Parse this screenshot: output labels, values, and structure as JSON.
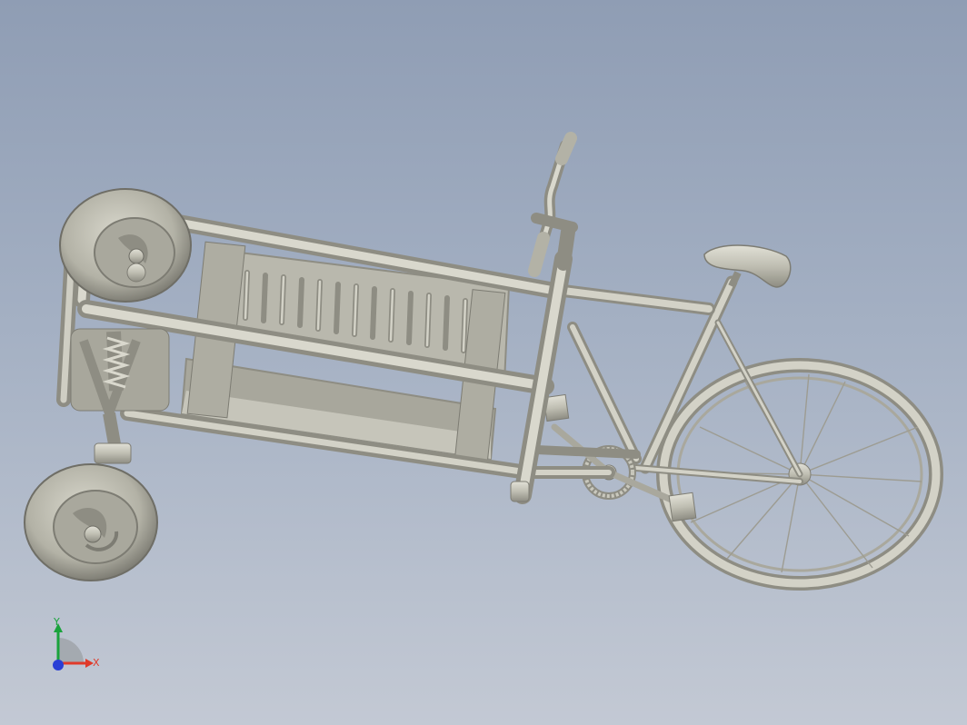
{
  "viewport": {
    "background_top": "#8f9db4",
    "background_bottom": "#c3c9d4",
    "model_color": "#c2c1b5"
  },
  "model": {
    "parts": [
      "front-left-wheel",
      "front-right-wheel",
      "front-suspension",
      "cargo-frame",
      "cargo-bench",
      "handlebar",
      "saddle",
      "chainring",
      "pedals",
      "rear-wheel"
    ]
  },
  "triad": {
    "x_label": "X",
    "y_label": "Y",
    "x_color": "#e03a2a",
    "y_color": "#19a33c",
    "z_color": "#2a3fd6"
  }
}
